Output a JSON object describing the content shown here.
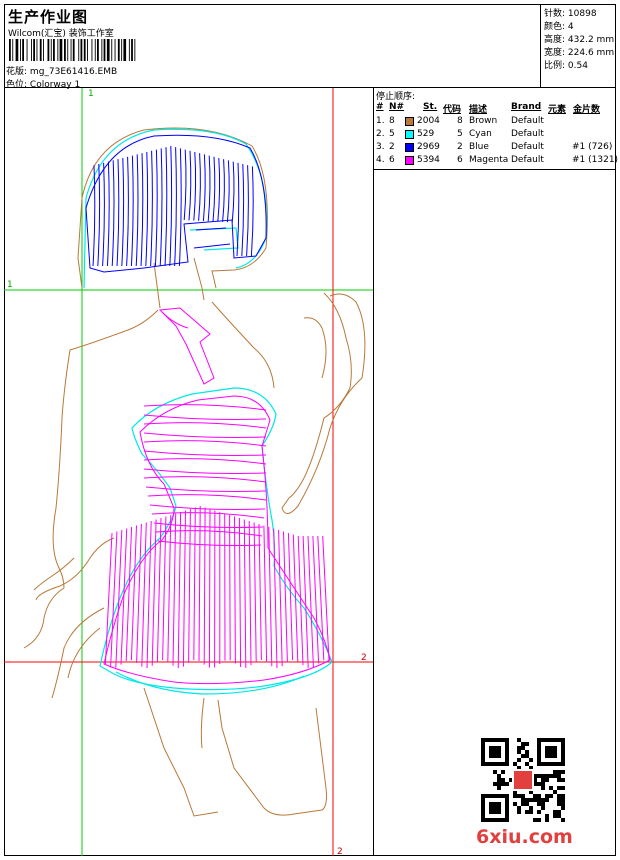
{
  "header": {
    "title": "生产作业图",
    "company": "Wilcom(汇宝) 装饰工作室",
    "design_label": "花版:",
    "design_file": "mg_73E61416.EMB",
    "colorway_label": "色位:",
    "colorway": "Colorway 1"
  },
  "stats": {
    "stitches_label": "针数:",
    "stitches": "10898",
    "colors_label": "颜色:",
    "colors": "4",
    "height_label": "高度:",
    "height": "432.2 mm",
    "width_label": "宽度:",
    "width": "224.6 mm",
    "scale_label": "比例:",
    "scale": "0.54"
  },
  "stop_sequence": {
    "title": "停止顺序:",
    "headers": {
      "idx": "#",
      "n": "N#",
      "st": "St.",
      "code": "代码",
      "desc": "描述",
      "brand": "Brand",
      "element": "元素",
      "sequin": "金片数"
    },
    "rows": [
      {
        "idx": "1.",
        "n": "8",
        "color": "#b8793a",
        "st": "2004",
        "code": "8",
        "desc": "Brown",
        "brand": "Default",
        "sequin": ""
      },
      {
        "idx": "2.",
        "n": "5",
        "color": "#00ffff",
        "st": "529",
        "code": "5",
        "desc": "Cyan",
        "brand": "Default",
        "sequin": ""
      },
      {
        "idx": "3.",
        "n": "2",
        "color": "#0000ff",
        "st": "2969",
        "code": "2",
        "desc": "Blue",
        "brand": "Default",
        "sequin": "#1 (726)"
      },
      {
        "idx": "4.",
        "n": "6",
        "color": "#ff00ff",
        "st": "5394",
        "code": "6",
        "desc": "Magenta",
        "brand": "Default",
        "sequin": "#1 (1321)"
      }
    ]
  },
  "markers": {
    "green_top": "1",
    "green_left": "1",
    "red_right": "2",
    "red_bottom": "2"
  },
  "watermark": {
    "site": "6xiu.com"
  },
  "colors": {
    "guide_green": "#00cc00",
    "guide_red": "#ff0000",
    "brown": "#b8793a",
    "cyan": "#00ffff",
    "blue": "#0000ff",
    "magenta": "#ff00ff"
  }
}
